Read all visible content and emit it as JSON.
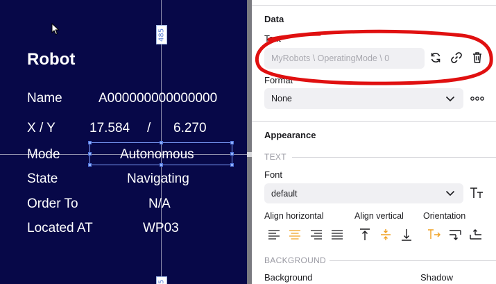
{
  "canvas": {
    "guide_top_label": "485",
    "guide_bottom_label": "5",
    "title": "Robot",
    "rows": [
      {
        "label": "Name",
        "value": "A000000000000000"
      },
      {
        "label": "X / Y",
        "x": "17.584",
        "sep": "/",
        "y": "6.270"
      },
      {
        "label": "Mode",
        "value": "Autonomous"
      },
      {
        "label": "State",
        "value": "Navigating"
      },
      {
        "label": "Order To",
        "value": "N/A"
      },
      {
        "label": "Located AT",
        "value": "WP03"
      }
    ]
  },
  "panel": {
    "data_title": "Data",
    "text_label": "Text",
    "text_placeholder": "MyRobots \\ OperatingMode \\ 0",
    "format_label": "Format",
    "format_value": "None",
    "appearance_title": "Appearance",
    "text_subhead": "TEXT",
    "font_label": "Font",
    "font_value": "default",
    "align_h_label": "Align horizontal",
    "align_v_label": "Align vertical",
    "orientation_label": "Orientation",
    "background_subhead": "BACKGROUND",
    "background_label": "Background",
    "shadow_label": "Shadow"
  },
  "colors": {
    "canvas_bg": "#070848",
    "accent": "#f0a020",
    "annotation": "#e01010"
  },
  "icons": [
    "cursor-arrow-icon",
    "refresh-icon",
    "link-icon",
    "trash-icon",
    "chevron-down-icon",
    "more-icon",
    "font-size-icon",
    "align-left-icon",
    "align-center-icon",
    "align-right-icon",
    "align-justify-icon",
    "align-top-icon",
    "align-middle-icon",
    "align-bottom-icon",
    "orientation-horizontal-icon",
    "orientation-down-icon",
    "orientation-up-icon"
  ]
}
